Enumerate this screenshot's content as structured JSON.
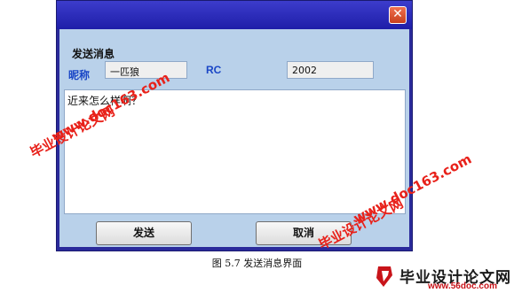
{
  "dialog": {
    "close_glyph": "✕",
    "section_title": "发送消息",
    "nickname_label": "昵称",
    "nickname_value": "一匹狼",
    "rc_label": "RC",
    "rc_value": "2002",
    "message_text": "近来怎么样啊？",
    "send_label": "发送",
    "cancel_label": "取消"
  },
  "caption": "图 5.7  发送消息界面",
  "watermarks": {
    "site_name": "毕业设计论文网",
    "url_upper": "www.doc163.com",
    "logo_url": "www.56doc.com",
    "color": "#e8211a"
  }
}
